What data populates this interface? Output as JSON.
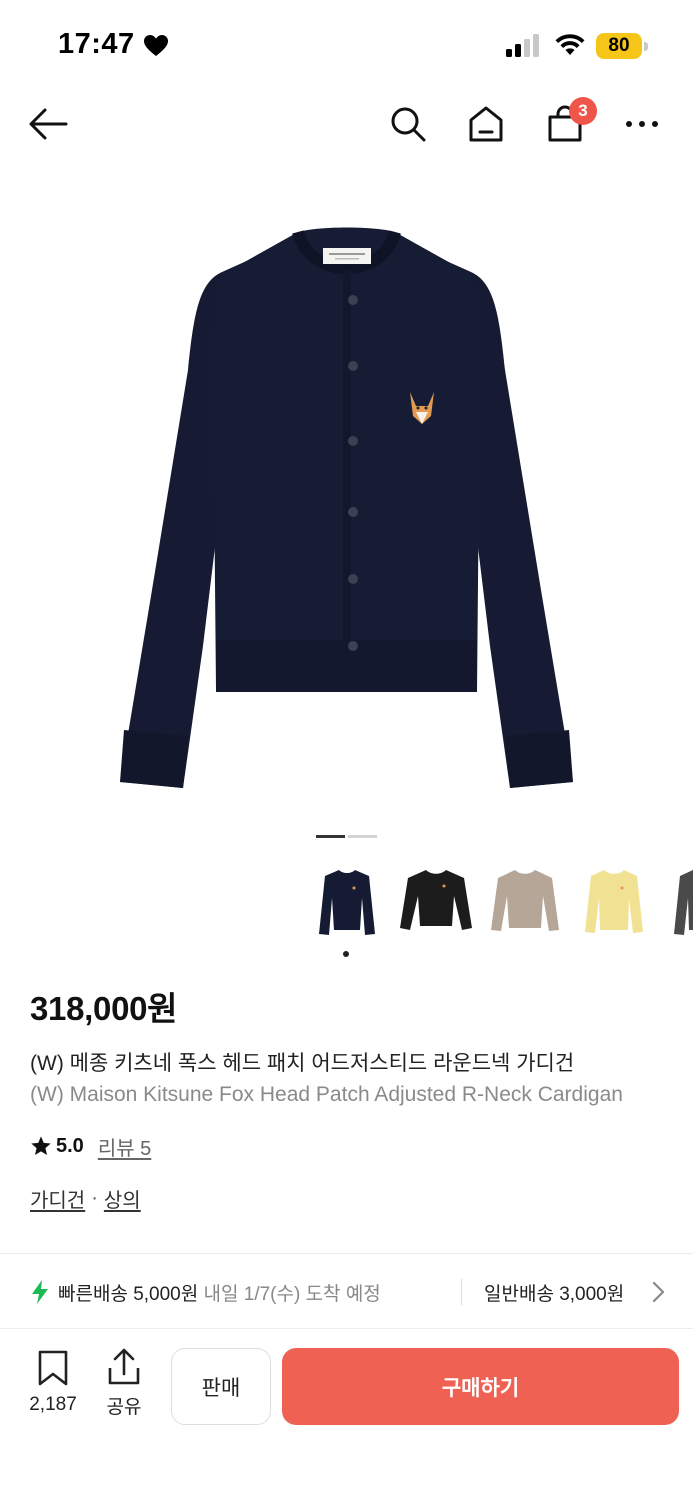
{
  "status_bar": {
    "time": "17:47",
    "battery": "80",
    "battery_color": "#f5c518"
  },
  "nav": {
    "back_icon": "arrow-left-icon",
    "icons": [
      "search-icon",
      "home-icon",
      "cart-icon",
      "more-icon"
    ],
    "cart_badge": "3",
    "badge_color": "#f0554a"
  },
  "gallery": {
    "page_count": 2,
    "current_page": 1,
    "thumbnails": [
      {
        "color_name": "navy",
        "color": "#151b33",
        "selected": true
      },
      {
        "color_name": "black",
        "color": "#1c1c1c",
        "selected": false
      },
      {
        "color_name": "beige",
        "color": "#b5a697",
        "selected": false
      },
      {
        "color_name": "yellow",
        "color": "#f1e293",
        "selected": false
      },
      {
        "color_name": "charcoal",
        "color": "#4a4a4c",
        "selected": false
      }
    ]
  },
  "product": {
    "price": "318,000원",
    "title_ko": "(W) 메종 키츠네 폭스 헤드 패치 어드저스티드 라운드넥 가디건",
    "title_en": "(W) Maison Kitsune Fox Head Patch Adjusted R-Neck Cardigan",
    "rating": "5.0",
    "review": "리뷰 5",
    "categories": [
      "가디건",
      "상의"
    ],
    "category_separator": "·"
  },
  "shipping": {
    "fast_label": "빠른배송 5,000원",
    "fast_eta": "내일 1/7(수) 도착 예정",
    "normal_label": "일반배송 3,000원"
  },
  "bottom_bar": {
    "bookmark_count": "2,187",
    "share_label": "공유",
    "sell_label": "판매",
    "buy_label": "구매하기",
    "buy_color": "#ef6253"
  }
}
